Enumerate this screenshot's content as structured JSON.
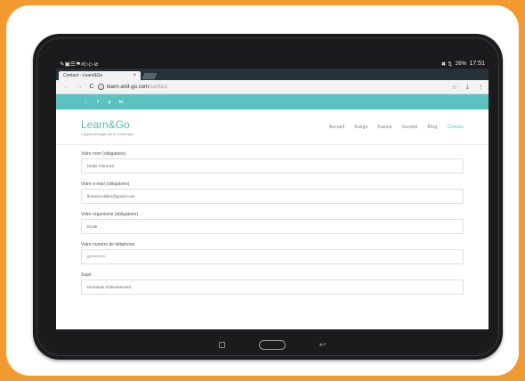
{
  "statusbar": {
    "left_icons": [
      "tools-icon",
      "image-icon",
      "notes-icon",
      "flag-icon",
      "grid-icon",
      "play-icon",
      "play-icon",
      "at-icon"
    ],
    "left_glyphs": "✎▣☰⚑#▷▷⊘",
    "right_glyphs": "✖ ⇅",
    "battery": "26%",
    "time": "17:51"
  },
  "browser": {
    "tab_title": "Contact - Learn&Go",
    "tab_close": "×",
    "url_host": "learn-and-go.com",
    "url_path": "/contact",
    "back": "←",
    "forward": "→",
    "reload": "C",
    "info": "i",
    "star": "☆",
    "download": "⤓",
    "menu": "⋮"
  },
  "social": {
    "icons": [
      "home-icon",
      "facebook-icon",
      "twitter-icon",
      "linkedin-icon"
    ],
    "home": "⌂",
    "facebook": "f",
    "twitter": "y",
    "linkedin": "in"
  },
  "site": {
    "brand": "Learn&Go",
    "tagline": "L'apprentissage par le numérique",
    "nav": [
      "Accueil",
      "Kaligo",
      "Kassis",
      "Société",
      "Blog",
      "Contact"
    ],
    "active_nav": "Contact",
    "accent_color": "#4dbdb9",
    "bar_color": "#5bc2bf"
  },
  "form": {
    "fields": [
      {
        "label": "Votre nom (obligatoire)",
        "value": "Didier Florence"
      },
      {
        "label": "Votre e-mail (obligatoire)",
        "value": "florence.didier@gmail.com"
      },
      {
        "label": "Votre organisme (obligatoire)",
        "value": "Ecole"
      },
      {
        "label": "Votre numéro de téléphone",
        "value": "07*********"
      },
      {
        "label": "Sujet",
        "value": "Demande d'abonnement"
      }
    ]
  },
  "android_nav": {
    "back": "↩"
  },
  "frame": {
    "background": "#f39a2e"
  }
}
